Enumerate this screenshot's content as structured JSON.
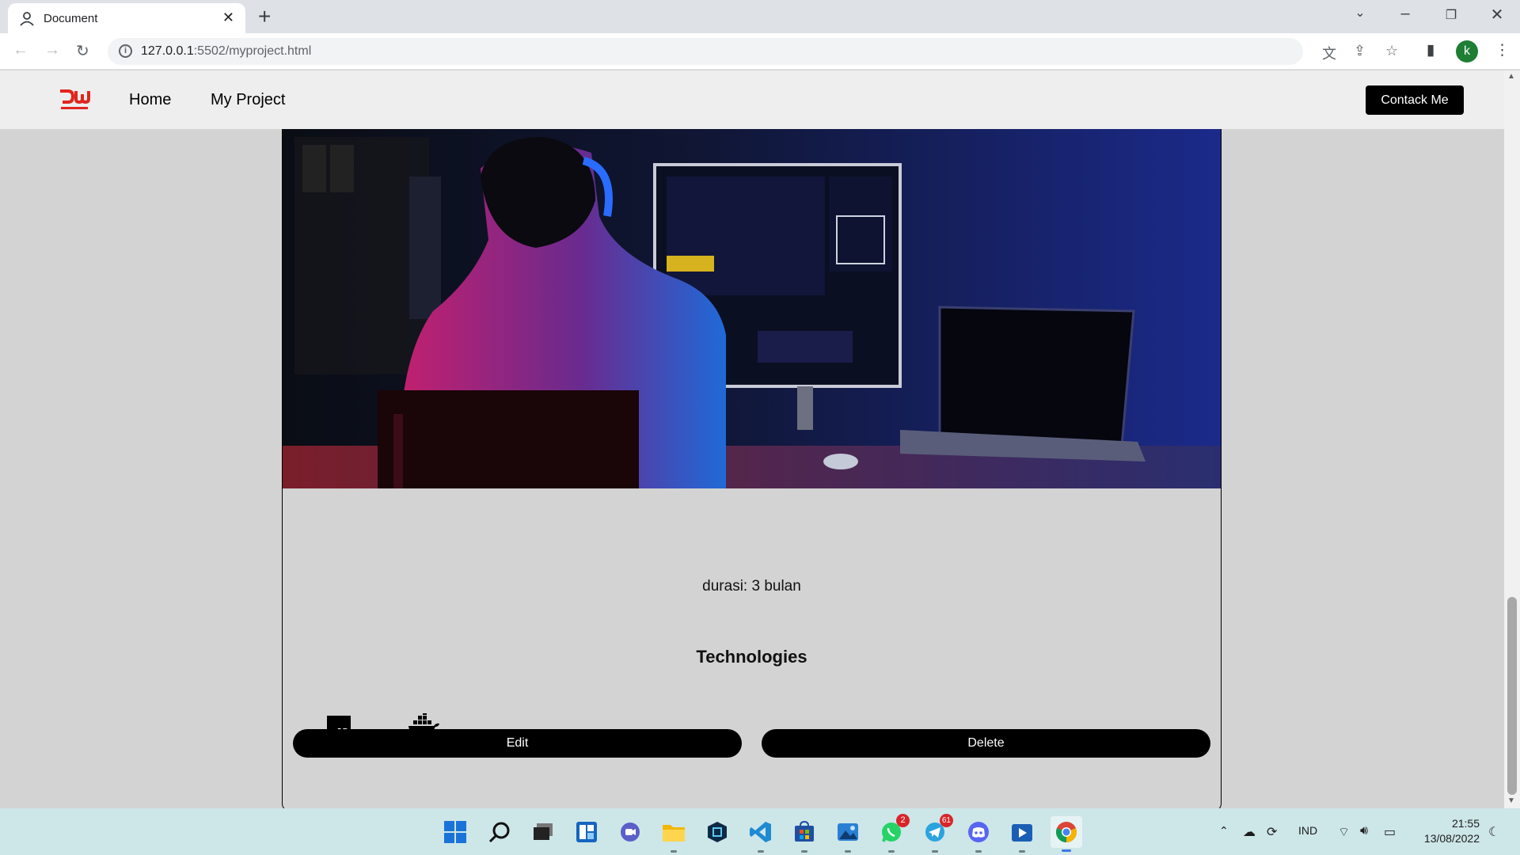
{
  "browser": {
    "tab_title": "Document",
    "url_host": "127.0.0.1",
    "url_rest": ":5502/myproject.html",
    "profile_initial": "k"
  },
  "site": {
    "logo_text": "DW",
    "nav": [
      {
        "label": "Home"
      },
      {
        "label": "My Project"
      }
    ],
    "contact_label": "Contack Me"
  },
  "project": {
    "duration": "durasi: 3 bulan",
    "tech_heading": "Technologies",
    "technologies": [
      {
        "name": "js-icon",
        "label": "JS"
      },
      {
        "name": "docker-icon",
        "label": ""
      }
    ],
    "edit_label": "Edit",
    "delete_label": "Delete"
  },
  "taskbar": {
    "whatsapp_badge": "2",
    "telegram_badge": "61",
    "language": "IND",
    "time": "21:55",
    "date": "13/08/2022"
  },
  "colors": {
    "page_bg": "#d3d3d3",
    "nav_bg": "#eeeeee",
    "button_bg": "#000000",
    "logo_red": "#e0261f",
    "taskbar_bg": "#cde6e8"
  }
}
